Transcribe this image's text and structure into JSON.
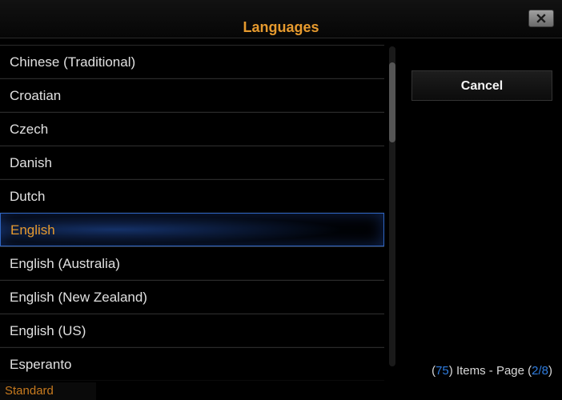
{
  "title": "Languages",
  "close_label": "×",
  "languages": [
    "Chinese (Traditional)",
    "Croatian",
    "Czech",
    "Danish",
    "Dutch",
    "English",
    "English (Australia)",
    "English (New Zealand)",
    "English (US)",
    "Esperanto"
  ],
  "selected_index": 5,
  "cancel_label": "Cancel",
  "footer": {
    "open": "(",
    "item_count": "75",
    "items_text": ") Items - Page (",
    "page": "2/8",
    "close": ")"
  },
  "status_label": "Standard"
}
